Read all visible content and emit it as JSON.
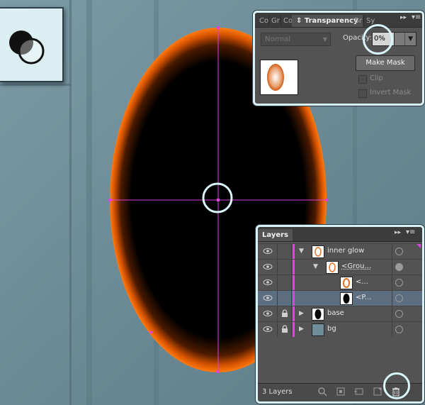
{
  "transparency": {
    "tabs": [
      "Co",
      "Gr",
      "Co",
      "Transparency",
      "Br",
      "Sy"
    ],
    "blend_mode": "Normal",
    "opacity_label": "Opacity:",
    "opacity_value": "0%",
    "make_mask_label": "Make Mask",
    "clip_label": "Clip",
    "invert_mask_label": "Invert Mask"
  },
  "layers": {
    "title": "Layers",
    "rows": [
      {
        "name": "inner glow",
        "color": "#d946d9"
      },
      {
        "name": "<Grou...",
        "color": "#d946d9"
      },
      {
        "name": "<...",
        "color": "#d946d9"
      },
      {
        "name": "<P...",
        "color": "#d946d9"
      },
      {
        "name": "base",
        "color": "#d946d9"
      },
      {
        "name": "bg",
        "color": "#d946d9"
      }
    ],
    "count_label": "3 Layers"
  },
  "colors": {
    "guide": "#e040e0",
    "glow": "#ff6a00",
    "panel_ring": "#d8f6fb"
  }
}
